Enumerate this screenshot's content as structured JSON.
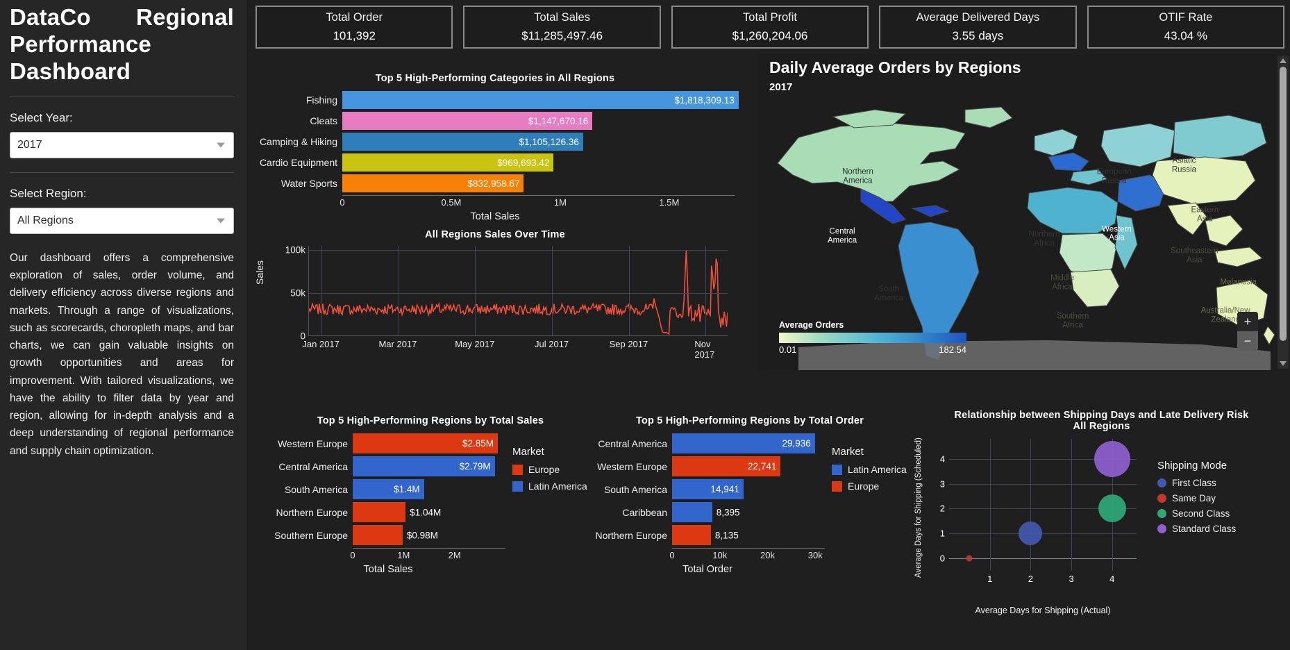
{
  "sidebar": {
    "title": "DataCo Regional Performance Dashboard",
    "year_label": "Select Year:",
    "year_value": "2017",
    "region_label": "Select Region:",
    "region_value": "All Regions",
    "description": "Our dashboard offers a comprehensive exploration of sales, order volume, and delivery efficiency across diverse regions and markets. Through a range of visualizations, such as scorecards, choropleth maps, and bar charts, we can gain valuable insights on growth opportunities and areas for improvement. With tailored visualizations, we have the ability to filter data by year and region, allowing for in-depth analysis and a deep understanding of regional performance and supply chain optimization."
  },
  "kpis": [
    {
      "title": "Total Order",
      "value": "101,392"
    },
    {
      "title": "Total Sales",
      "value": "$11,285,497.46"
    },
    {
      "title": "Total Profit",
      "value": "$1,260,204.06"
    },
    {
      "title": "Average Delivered Days",
      "value": "3.55 days"
    },
    {
      "title": "OTIF Rate",
      "value": "43.04 %"
    }
  ],
  "chart_data": [
    {
      "id": "categories",
      "type": "bar",
      "orientation": "horizontal",
      "title": "Top 5 High-Performing Categories in All Regions",
      "xlabel": "Total Sales",
      "ylabel": "",
      "xlim": [
        0,
        1800000
      ],
      "xticks": [
        "0",
        "0.5M",
        "1M",
        "1.5M"
      ],
      "xtick_values": [
        0,
        500000,
        1000000,
        1500000
      ],
      "grid": false,
      "categories": [
        "Fishing",
        "Cleats",
        "Camping & Hiking",
        "Cardio Equipment",
        "Water Sports"
      ],
      "values": [
        1818309.13,
        1147670.16,
        1105126.36,
        969693.42,
        832958.67
      ],
      "labels": [
        "$1,818,309.13",
        "$1,147,670.16",
        "$1,105,126.36",
        "$969,693.42",
        "$832,958.67"
      ],
      "colors": [
        "#4596dd",
        "#e87cc3",
        "#2d7ebb",
        "#c8c410",
        "#f98007"
      ]
    },
    {
      "id": "sales_over_time",
      "type": "line",
      "title": "All Regions Sales Over Time",
      "xlabel": "",
      "ylabel": "Sales",
      "ylim": [
        0,
        105000
      ],
      "yticks": [
        "0",
        "50k",
        "100k"
      ],
      "ytick_values": [
        0,
        50000,
        100000
      ],
      "xticks": [
        "Jan 2017",
        "Mar 2017",
        "May 2017",
        "Jul 2017",
        "Sep 2017",
        "Nov 2017"
      ],
      "grid": true,
      "line_color": "#f04f3a",
      "series_note": "Daily sales, steady ~30k Jan-Oct with a large spike near early Nov (~100k) then volatile decline."
    },
    {
      "id": "map",
      "type": "choropleth",
      "title": "Daily Average Orders by Regions",
      "subtitle": "2017",
      "legend_title": "Average Orders",
      "legend_min": "0.01",
      "legend_max": "182.54",
      "regions": [
        {
          "name": "Northern America",
          "x": 19.5,
          "y": 29,
          "value": 40,
          "color": "#a8ddb5",
          "text": "#333333"
        },
        {
          "name": "Central America",
          "x": 16.5,
          "y": 51,
          "value": 182.54,
          "color": "#2346c6",
          "text": "#ffffff"
        },
        {
          "name": "South America",
          "x": 25.5,
          "y": 72,
          "value": 120,
          "color": "#3a8fd0",
          "text": "#333333"
        },
        {
          "name": "Northern Africa",
          "x": 55.5,
          "y": 52,
          "value": 75,
          "color": "#4fb3cf",
          "text": "#333333"
        },
        {
          "name": "Middle Africa",
          "x": 59,
          "y": 68,
          "value": 25,
          "color": "#c3e8c8",
          "text": "#4a4a3a"
        },
        {
          "name": "Southern Africa",
          "x": 61,
          "y": 82,
          "value": 20,
          "color": "#d9eec0",
          "text": "#4a4a3a"
        },
        {
          "name": "Western Asia",
          "x": 69.5,
          "y": 50,
          "value": 150,
          "color": "#2f6fd0",
          "text": "#ffffff"
        },
        {
          "name": "European Russia",
          "x": 69,
          "y": 29,
          "value": 60,
          "color": "#8fd2d6",
          "text": "#333333"
        },
        {
          "name": "Asiatic Russia",
          "x": 82.5,
          "y": 25,
          "value": 55,
          "color": "#7fcbd0",
          "text": "#333333"
        },
        {
          "name": "Eastern Asia",
          "x": 86.5,
          "y": 43,
          "value": 15,
          "color": "#e6f2bb",
          "text": "#4a4a3a"
        },
        {
          "name": "Southeastern Asia",
          "x": 84.5,
          "y": 58,
          "value": 12,
          "color": "#e6f2bb",
          "text": "#4a4a3a"
        },
        {
          "name": "Melanesia",
          "x": 93,
          "y": 68,
          "value": 8,
          "color": "#e6f2bb",
          "text": "#6b6b4a"
        },
        {
          "name": "Australia/New Zealand",
          "x": 90.5,
          "y": 80,
          "value": 10,
          "color": "#e6f2bb",
          "text": "#6b6b4a"
        }
      ],
      "zoom_in_label": "+",
      "zoom_out_label": "−"
    },
    {
      "id": "regions_sales",
      "type": "bar",
      "orientation": "horizontal",
      "title": "Top 5 High-Performing Regions by Total Sales",
      "xlabel": "Total Sales",
      "xticks": [
        "0",
        "1M",
        "2M"
      ],
      "xtick_values": [
        0,
        1000000,
        2000000
      ],
      "xlim": [
        0,
        3000000
      ],
      "grid": false,
      "categories": [
        "Western Europe",
        "Central America",
        "South America",
        "Northern Europe",
        "Southern Europe"
      ],
      "values": [
        2850000,
        2790000,
        1400000,
        1040000,
        980000
      ],
      "labels": [
        "$2.85M",
        "$2.79M",
        "$1.4M",
        "$1.04M",
        "$0.98M"
      ],
      "markets": [
        "Europe",
        "Latin America",
        "Latin America",
        "Europe",
        "Europe"
      ],
      "legend_title": "Market",
      "legend": [
        {
          "label": "Europe",
          "color": "#dc3912"
        },
        {
          "label": "Latin America",
          "color": "#3366cc"
        }
      ]
    },
    {
      "id": "regions_orders",
      "type": "bar",
      "orientation": "horizontal",
      "title": "Top 5 High-Performing Regions by Total Order",
      "xlabel": "Total Order",
      "xticks": [
        "0",
        "10k",
        "20k",
        "30k"
      ],
      "xtick_values": [
        0,
        10000,
        20000,
        30000
      ],
      "xlim": [
        0,
        32000
      ],
      "grid": false,
      "categories": [
        "Central America",
        "Western Europe",
        "South America",
        "Caribbean",
        "Northern Europe"
      ],
      "values": [
        29936,
        22741,
        14941,
        8395,
        8135
      ],
      "labels": [
        "29,936",
        "22,741",
        "14,941",
        "8,395",
        "8,135"
      ],
      "markets": [
        "Latin America",
        "Europe",
        "Latin America",
        "Latin America",
        "Europe"
      ],
      "legend_title": "Market",
      "legend": [
        {
          "label": "Latin America",
          "color": "#3366cc"
        },
        {
          "label": "Europe",
          "color": "#dc3912"
        }
      ]
    },
    {
      "id": "shipping_scatter",
      "type": "scatter",
      "title": "Relationship between Shipping Days and Late Delivery Risk",
      "subtitle": "All Regions",
      "xlabel": "Average Days for Shipping (Actual)",
      "ylabel": "Average Days for Shipping (Scheduled)",
      "xlim": [
        0,
        4.6
      ],
      "ylim": [
        -0.5,
        4.8
      ],
      "xticks": [
        "1",
        "2",
        "3",
        "4"
      ],
      "xtick_values": [
        1,
        2,
        3,
        4
      ],
      "yticks": [
        "0",
        "1",
        "2",
        "3",
        "4"
      ],
      "ytick_values": [
        0,
        1,
        2,
        3,
        4
      ],
      "grid": true,
      "legend_title": "Shipping Mode",
      "points": [
        {
          "name": "Same Day",
          "x": 0.5,
          "y": 0,
          "size": 9,
          "color": "#c0392b"
        },
        {
          "name": "First Class",
          "x": 2,
          "y": 1,
          "size": 34,
          "color": "#4359b0"
        },
        {
          "name": "Second Class",
          "x": 4,
          "y": 2,
          "size": 40,
          "color": "#2fa87a"
        },
        {
          "name": "Standard Class",
          "x": 4,
          "y": 4,
          "size": 52,
          "color": "#8e5fd0"
        }
      ],
      "legend": [
        {
          "label": "First Class",
          "color": "#4359b0"
        },
        {
          "label": "Same Day",
          "color": "#c0392b"
        },
        {
          "label": "Second Class",
          "color": "#2fa87a"
        },
        {
          "label": "Standard Class",
          "color": "#8e5fd0"
        }
      ]
    }
  ]
}
